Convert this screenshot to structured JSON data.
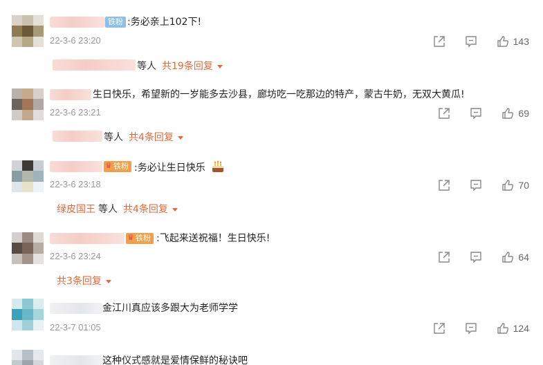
{
  "comments": [
    {
      "badge": "铁粉",
      "text": ":务必亲上102下!",
      "time": "22-3-6 23:20",
      "likes": "143",
      "reply_name": "",
      "reply_etc": "等人",
      "reply_count": "共19条回复"
    },
    {
      "badge": "",
      "text": "生日快乐，希望新的一岁能多去沙县，廊坊吃一吃那边的特产，蒙古牛奶，无双大黄瓜!",
      "time": "22-3-6 23:21",
      "likes": "69",
      "reply_name": "",
      "reply_etc": "等人",
      "reply_count": "共4条回复"
    },
    {
      "badge": "铁粉",
      "text": ":务必让生日快乐",
      "emoji": "cake-emoji",
      "time": "22-3-6 23:18",
      "likes": "70",
      "reply_name": "绿皮国王",
      "reply_etc": "等人",
      "reply_count": "共4条回复"
    },
    {
      "badge": "铁粉",
      "text": ":飞起来送祝福！生日快乐!",
      "time": "22-3-6 23:24",
      "likes": "64",
      "reply_name": "",
      "reply_etc": "",
      "reply_count": "共3条回复"
    },
    {
      "badge": "",
      "text": "金江川真应该多跟大为老师学学",
      "time": "22-3-7 01:05",
      "likes": "124"
    },
    {
      "badge": "",
      "text": "这种仪式感就是爱情保鲜的秘诀吧"
    }
  ],
  "icons": {
    "share": "share-icon",
    "comment": "comment-icon",
    "like": "thumbs-up-icon"
  },
  "colors": {
    "accent": "#e16a3c",
    "badge_fan": "#8fbfe6",
    "badge_crown": "#f0a04a",
    "muted": "#999999"
  }
}
